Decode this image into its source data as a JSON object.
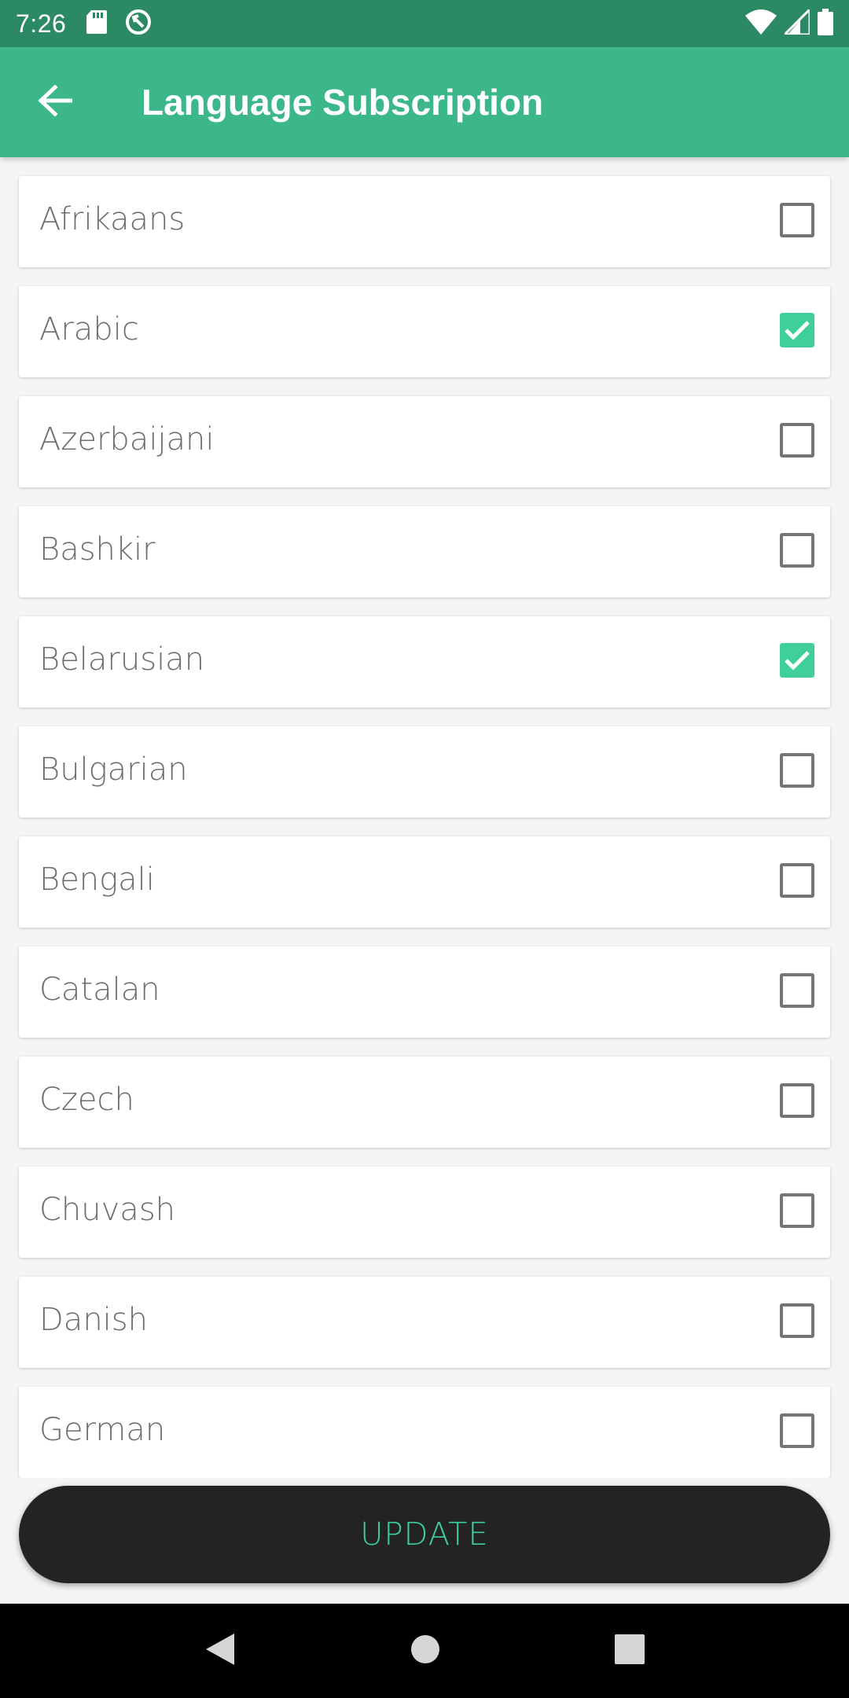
{
  "status_bar": {
    "time": "7:26",
    "icons": [
      "sd-card-icon",
      "sync-icon",
      "wifi-icon",
      "signal-icon",
      "battery-icon"
    ]
  },
  "app_bar": {
    "title": "Language Subscription",
    "back_icon": "arrow-left-icon"
  },
  "languages": [
    {
      "label": "Afrikaans",
      "checked": false
    },
    {
      "label": "Arabic",
      "checked": true
    },
    {
      "label": "Azerbaijani",
      "checked": false
    },
    {
      "label": "Bashkir",
      "checked": false
    },
    {
      "label": "Belarusian",
      "checked": true
    },
    {
      "label": "Bulgarian",
      "checked": false
    },
    {
      "label": "Bengali",
      "checked": false
    },
    {
      "label": "Catalan",
      "checked": false
    },
    {
      "label": "Czech",
      "checked": false
    },
    {
      "label": "Chuvash",
      "checked": false
    },
    {
      "label": "Danish",
      "checked": false
    },
    {
      "label": "German",
      "checked": false
    }
  ],
  "update_button": {
    "label": "UPDATE"
  },
  "colors": {
    "status_bar": "#2b8a63",
    "app_bar": "#3bb78a",
    "accent": "#3fd09a",
    "button_bg": "#232323"
  },
  "nav_bar": {
    "icons": [
      "back-triangle-icon",
      "home-circle-icon",
      "recents-square-icon"
    ]
  }
}
